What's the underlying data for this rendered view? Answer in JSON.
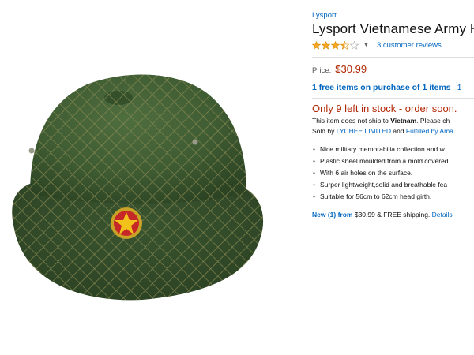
{
  "product": {
    "image_alt": "green military pith helmet with net and star badge",
    "brand": "Lysport",
    "title": "Lysport Vietnamese Army He",
    "rating": 3.5,
    "reviews_text": "3 customer reviews",
    "price_label": "Price:",
    "price": "$30.99",
    "promo_text": "1 free items on purchase of 1 items",
    "promo_extra": "1",
    "stock_text": "Only 9 left in stock - order soon.",
    "ship_note_prefix": "This item does not ship to ",
    "ship_note_country": "Vietnam",
    "ship_note_suffix": ". Please ch",
    "sold_by_prefix": "Sold by ",
    "seller": "LYCHEE LIMITED",
    "sold_by_and": " and ",
    "fulfilled": "Fulfilled by Ama",
    "bullets": [
      "Nice military memorabilia collection and w",
      "Plastic sheel moulded from a mold covered",
      "With 6 air holes on the surface.",
      "Surper lightweight,solid and breathable fea",
      "Suitable for 56cm to 62cm head girth."
    ],
    "offer_new": "New (1) from",
    "offer_price": " $30.99 & FREE shipping.",
    "offer_details": "Details"
  },
  "colors": {
    "helmet": "#3e5b32",
    "net": "#8a8a52",
    "badge_red": "#c62828",
    "star_gold": "#f2c21b",
    "link": "#0066c0",
    "price_red": "#b12704"
  }
}
